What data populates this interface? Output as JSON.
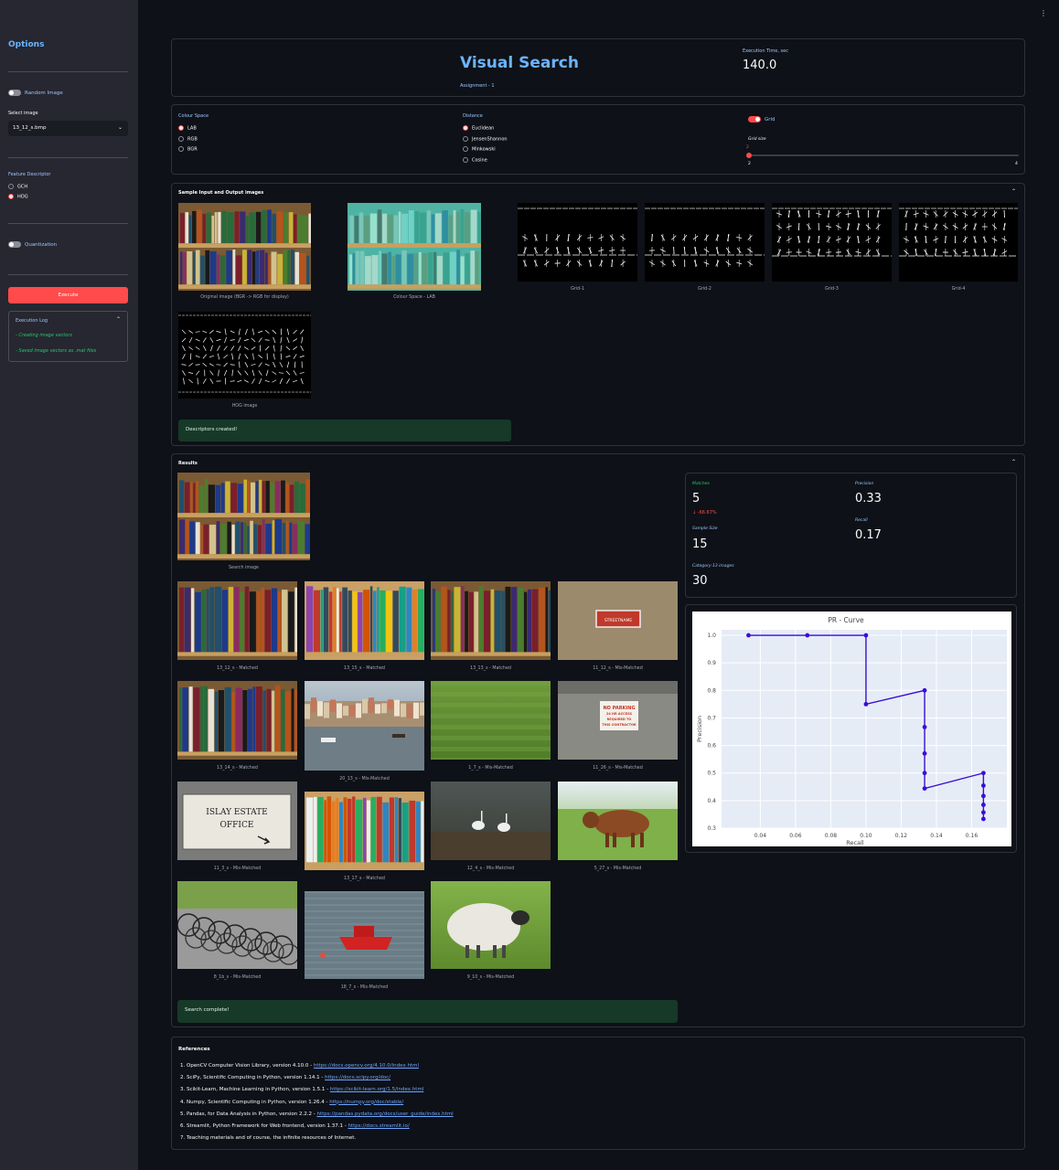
{
  "sidebar": {
    "title": "Options",
    "random_image_label": "Random Image",
    "select_image_label": "Select image",
    "select_image_value": "13_12_s.bmp",
    "feature_descriptor_label": "Feature Descriptor",
    "descriptors": [
      "GCH",
      "HOG"
    ],
    "selected_descriptor": "HOG",
    "quantization_label": "Quantization",
    "execute_label": "Execute",
    "log_title": "Execution Log",
    "log_lines": [
      "- Creating image vectors",
      "- Saved image vectors as .mat files"
    ]
  },
  "header": {
    "title": "Visual Search",
    "assignment_label": "Assignment - 1",
    "exec_time_label": "Execution Time, sec",
    "exec_time_value": "140.0"
  },
  "controls": {
    "colour_space_label": "Colour Space",
    "colour_spaces": [
      "LAB",
      "RGB",
      "BGR"
    ],
    "selected_colour_space": "LAB",
    "distance_label": "Distance",
    "distances": [
      "Euclidean",
      "JensenShannon",
      "Minkowski",
      "Cosine"
    ],
    "selected_distance": "Euclidean",
    "grid_label": "Grid",
    "grid_size_label": "Grid size",
    "grid_size_value": "2",
    "grid_size_min": "2",
    "grid_size_max": "4"
  },
  "samples": {
    "title": "Sample Input and Output images",
    "captions": [
      "Original image (BGR -> RGB for display)",
      "Colour Space - LAB",
      "Grid-1",
      "Grid-2",
      "Grid-3",
      "Grid-4",
      "HOG image"
    ],
    "success": "Descriptors created!"
  },
  "results": {
    "title": "Results",
    "search_caption": "Search image",
    "items": [
      {
        "caption": "13_12_s - Matched",
        "kind": "books"
      },
      {
        "caption": "13_15_s - Matched",
        "kind": "books2"
      },
      {
        "caption": "13_13_s - Matched",
        "kind": "books"
      },
      {
        "caption": "11_12_s - Mis-Matched",
        "kind": "sign"
      },
      {
        "caption": "13_14_s - Matched",
        "kind": "books"
      },
      {
        "caption": "20_13_s - Mis-Matched",
        "kind": "harbor"
      },
      {
        "caption": "1_7_s - Mis-Matched",
        "kind": "grass"
      },
      {
        "caption": "11_26_s - Mis-Matched",
        "kind": "wall"
      },
      {
        "caption": "11_3_s - Mis-Matched",
        "kind": "estate"
      },
      {
        "caption": "13_17_s - Matched",
        "kind": "books2"
      },
      {
        "caption": "12_4_s - Mis-Matched",
        "kind": "swans"
      },
      {
        "caption": "5_27_s - Mis-Matched",
        "kind": "cow"
      },
      {
        "caption": "8_1b_s - Mis-Matched",
        "kind": "bikes"
      },
      {
        "caption": "18_7_s - Mis-Matched",
        "kind": "boat"
      },
      {
        "caption": "9_10_s - Mis-Matched",
        "kind": "sheep"
      }
    ],
    "success": "Search complete!",
    "sign_text": [
      "STREETNAME",
      "NO PARKING",
      "24 HR ACCESS",
      "REQUIRED TO",
      "THIS CONTRACTOR"
    ],
    "estate_text": [
      "ISLAY ESTATE",
      "OFFICE"
    ]
  },
  "metrics": {
    "matches_label": "Matches",
    "matches_value": "5",
    "matches_delta": "-66.67%",
    "precision_label": "Precision",
    "precision_value": "0.33",
    "sample_size_label": "Sample Size",
    "sample_size_value": "15",
    "recall_label": "Recall",
    "recall_value": "0.17",
    "category_label": "Category-13 images",
    "category_value": "30"
  },
  "chart_data": {
    "type": "line",
    "title": "PR - Curve",
    "xlabel": "Recall",
    "ylabel": "Precision",
    "xlim": [
      0.018,
      0.18
    ],
    "ylim": [
      0.3,
      1.02
    ],
    "xticks": [
      "0.04",
      "0.06",
      "0.08",
      "0.10",
      "0.12",
      "0.14",
      "0.16"
    ],
    "yticks": [
      "1.0",
      "0.9",
      "0.8",
      "0.7",
      "0.6",
      "0.5",
      "0.4",
      "0.3"
    ],
    "x": [
      0.0333,
      0.0667,
      0.1,
      0.1,
      0.1333,
      0.1333,
      0.1333,
      0.1333,
      0.1333,
      0.1667,
      0.1667,
      0.1667,
      0.1667,
      0.1667,
      0.1667
    ],
    "y": [
      1.0,
      1.0,
      1.0,
      0.75,
      0.8,
      0.667,
      0.571,
      0.5,
      0.444,
      0.5,
      0.4545,
      0.4167,
      0.3846,
      0.3571,
      0.3333
    ],
    "line_color": "#3b0dd6",
    "background": "#e5ecf6"
  },
  "references": {
    "title": "References",
    "items": [
      {
        "text": "OpenCV Computer Vision Library, version 4.10.0 - ",
        "link": "https://docs.opencv.org/4.10.0/index.html"
      },
      {
        "text": "SciPy, Scientific Computing in Python, version 1.14.1 - ",
        "link": "https://docs.scipy.org/doc/"
      },
      {
        "text": "Scikit-Learn, Machine Learning in Python, version 1.5.1 - ",
        "link": "https://scikit-learn.org/1.5/index.html"
      },
      {
        "text": "Numpy, Scientific Computing in Python, version 1.26.4 - ",
        "link": "https://numpy.org/doc/stable/"
      },
      {
        "text": "Pandas, for Data Analysis in Python, version 2.2.2 - ",
        "link": "https://pandas.pydata.org/docs/user_guide/index.html"
      },
      {
        "text": "Streamlit, Python Framework for Web frontend, version 1.37.1 - ",
        "link": "https://docs.streamlit.io/"
      },
      {
        "text": "Teaching materials and of course, the infinite resources of Internet.",
        "link": ""
      }
    ]
  },
  "menu_icon": "⋮"
}
